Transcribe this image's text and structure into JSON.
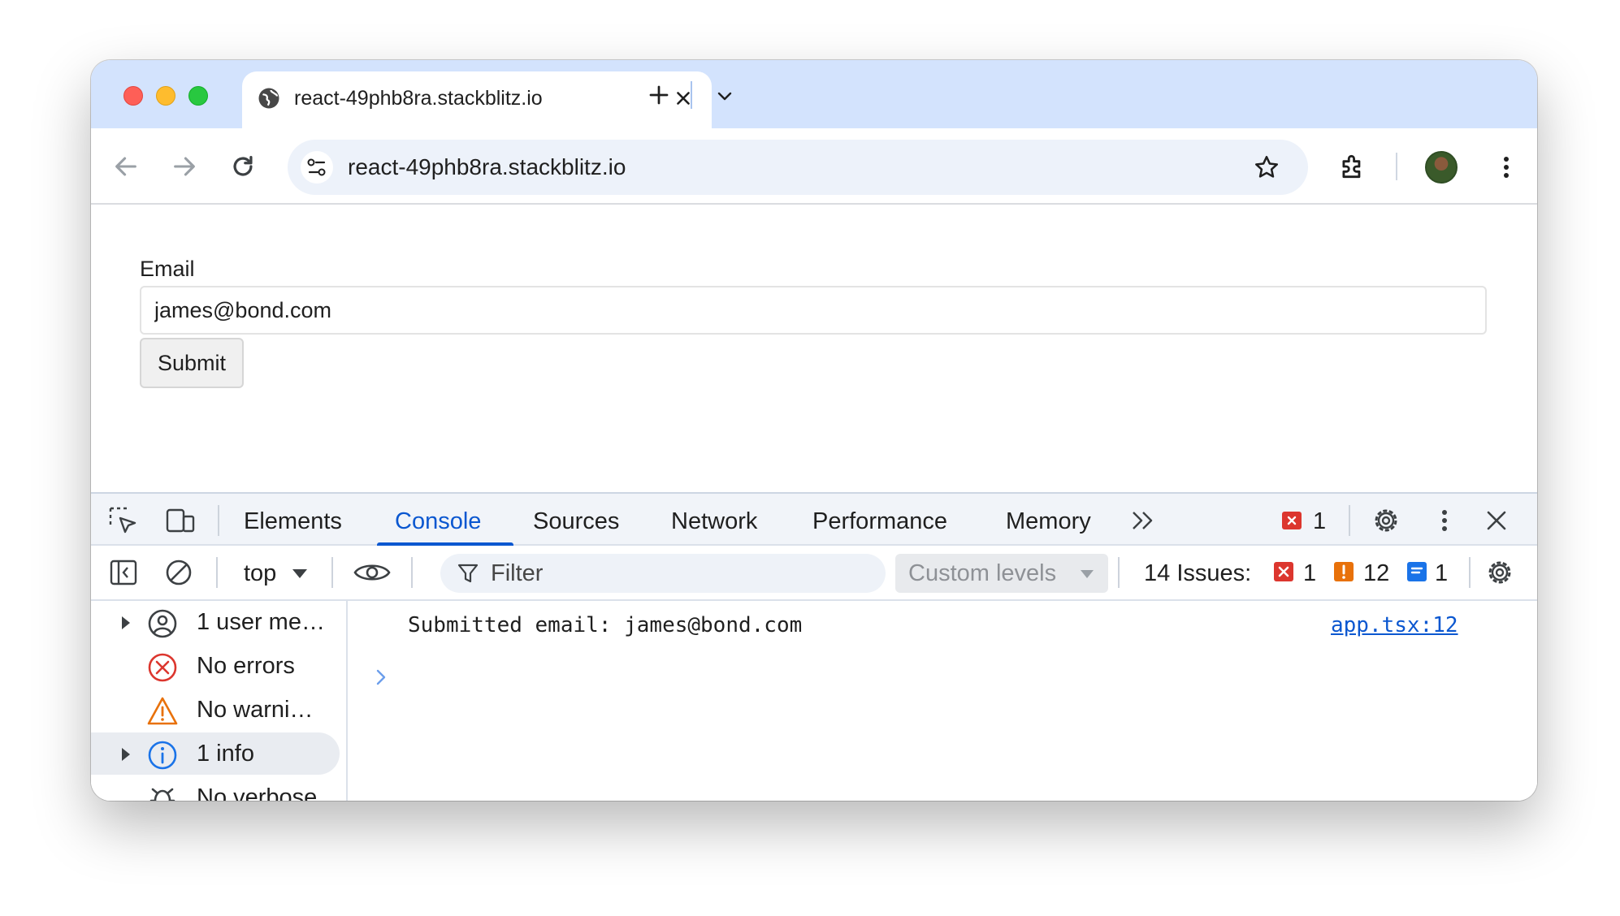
{
  "browser": {
    "tab": {
      "title": "react-49phb8ra.stackblitz.io"
    },
    "omnibox": {
      "url": "react-49phb8ra.stackblitz.io"
    },
    "icons": [
      "globe-icon",
      "close-icon",
      "plus-icon",
      "chevron-down-icon",
      "back-arrow-icon",
      "forward-arrow-icon",
      "reload-icon",
      "site-settings-icon",
      "star-icon",
      "extensions-icon",
      "avatar",
      "kebab-menu-icon"
    ]
  },
  "page": {
    "email_label": "Email",
    "email_value": "james@bond.com",
    "submit_label": "Submit"
  },
  "devtools": {
    "tabs": [
      "Elements",
      "Console",
      "Sources",
      "Network",
      "Performance",
      "Memory"
    ],
    "active_tab": "Console",
    "error_count": "1",
    "toolbar": {
      "context": "top",
      "filter_placeholder": "Filter",
      "levels": "Custom levels",
      "issues_label": "14 Issues:",
      "issues_errors": "1",
      "issues_warnings": "12",
      "issues_info": "1"
    },
    "sidebar": [
      {
        "label": "1 user me…",
        "icon": "user-icon",
        "expandable": true
      },
      {
        "label": "No errors",
        "icon": "error-circle-icon",
        "expandable": false
      },
      {
        "label": "No warni…",
        "icon": "warning-triangle-icon",
        "expandable": false
      },
      {
        "label": "1 info",
        "icon": "info-circle-icon",
        "expandable": true,
        "selected": true
      },
      {
        "label": "No verbose",
        "icon": "bug-icon",
        "expandable": false
      }
    ],
    "console": {
      "message": "Submitted email: james@bond.com",
      "source": "app.tsx:12"
    }
  },
  "colors": {
    "tabstrip": "#d3e3fd",
    "accent": "#0b57d0",
    "error": "#dc362e",
    "warning": "#e8710a",
    "info": "#1a73e8"
  }
}
